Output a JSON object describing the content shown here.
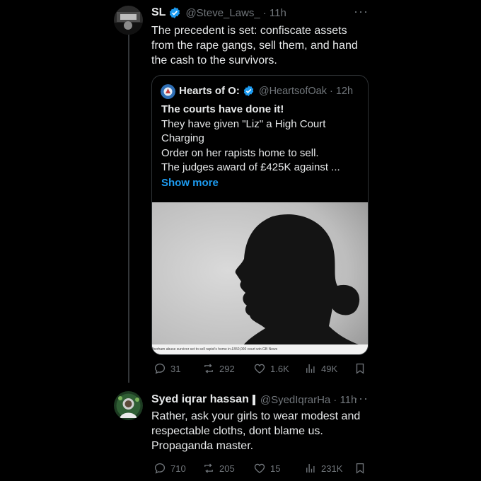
{
  "tweet1": {
    "display_name": "SL",
    "handle": "@Steve_Laws_",
    "time": "· 11h",
    "text": [
      "The precedent is set: confiscate assets",
      "from the rape gangs, sell them, and hand",
      "the cash to the survivors."
    ],
    "more_icon": "more-horizontal-icon",
    "quote": {
      "display_name": "Hearts of O:",
      "handle": "@HeartsofOak",
      "time": "· 12h",
      "headline": "The courts have done it!",
      "lines": [
        "They have given \"Liz\" a High Court",
        "Charging",
        "Order on her rapists home to sell.",
        "The judges award of £425K against ..."
      ],
      "show_more": "Show more",
      "image_caption": "therham abuse survivor set to sell rapist's home in £450,000 court win GB News"
    },
    "actions": {
      "replies": "31",
      "reposts": "292",
      "likes": "1.6K",
      "views": "49K"
    }
  },
  "tweet2": {
    "display_name": "Syed iqrar hassan",
    "handle": "@SyedIqrarHa",
    "time": "· 11h",
    "text": [
      "Rather, ask your girls to wear modest and",
      "respectable cloths, dont blame us.",
      "Propaganda master."
    ],
    "actions": {
      "replies": "710",
      "reposts": "205",
      "likes": "15",
      "views": "231K"
    }
  },
  "colors": {
    "background": "#000000",
    "text": "#e7e9ea",
    "secondary": "#71767b",
    "accent": "#1d9bf0",
    "border": "#2f3336"
  }
}
